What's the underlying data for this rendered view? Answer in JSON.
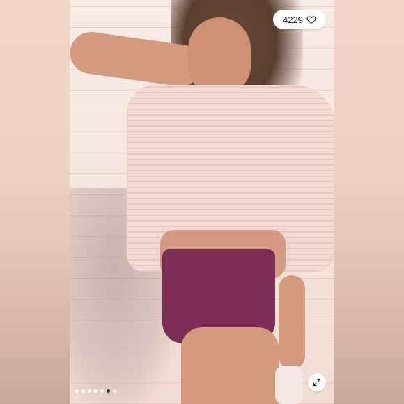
{
  "likes": {
    "count": "4229",
    "icon": "heart-icon"
  },
  "carousel": {
    "dot_count": 7,
    "active_index": 5
  },
  "expand_button": {
    "icon": "expand-icon"
  },
  "colors": {
    "shorts": "#7b2f55",
    "shirt": "#f3d7d2"
  }
}
